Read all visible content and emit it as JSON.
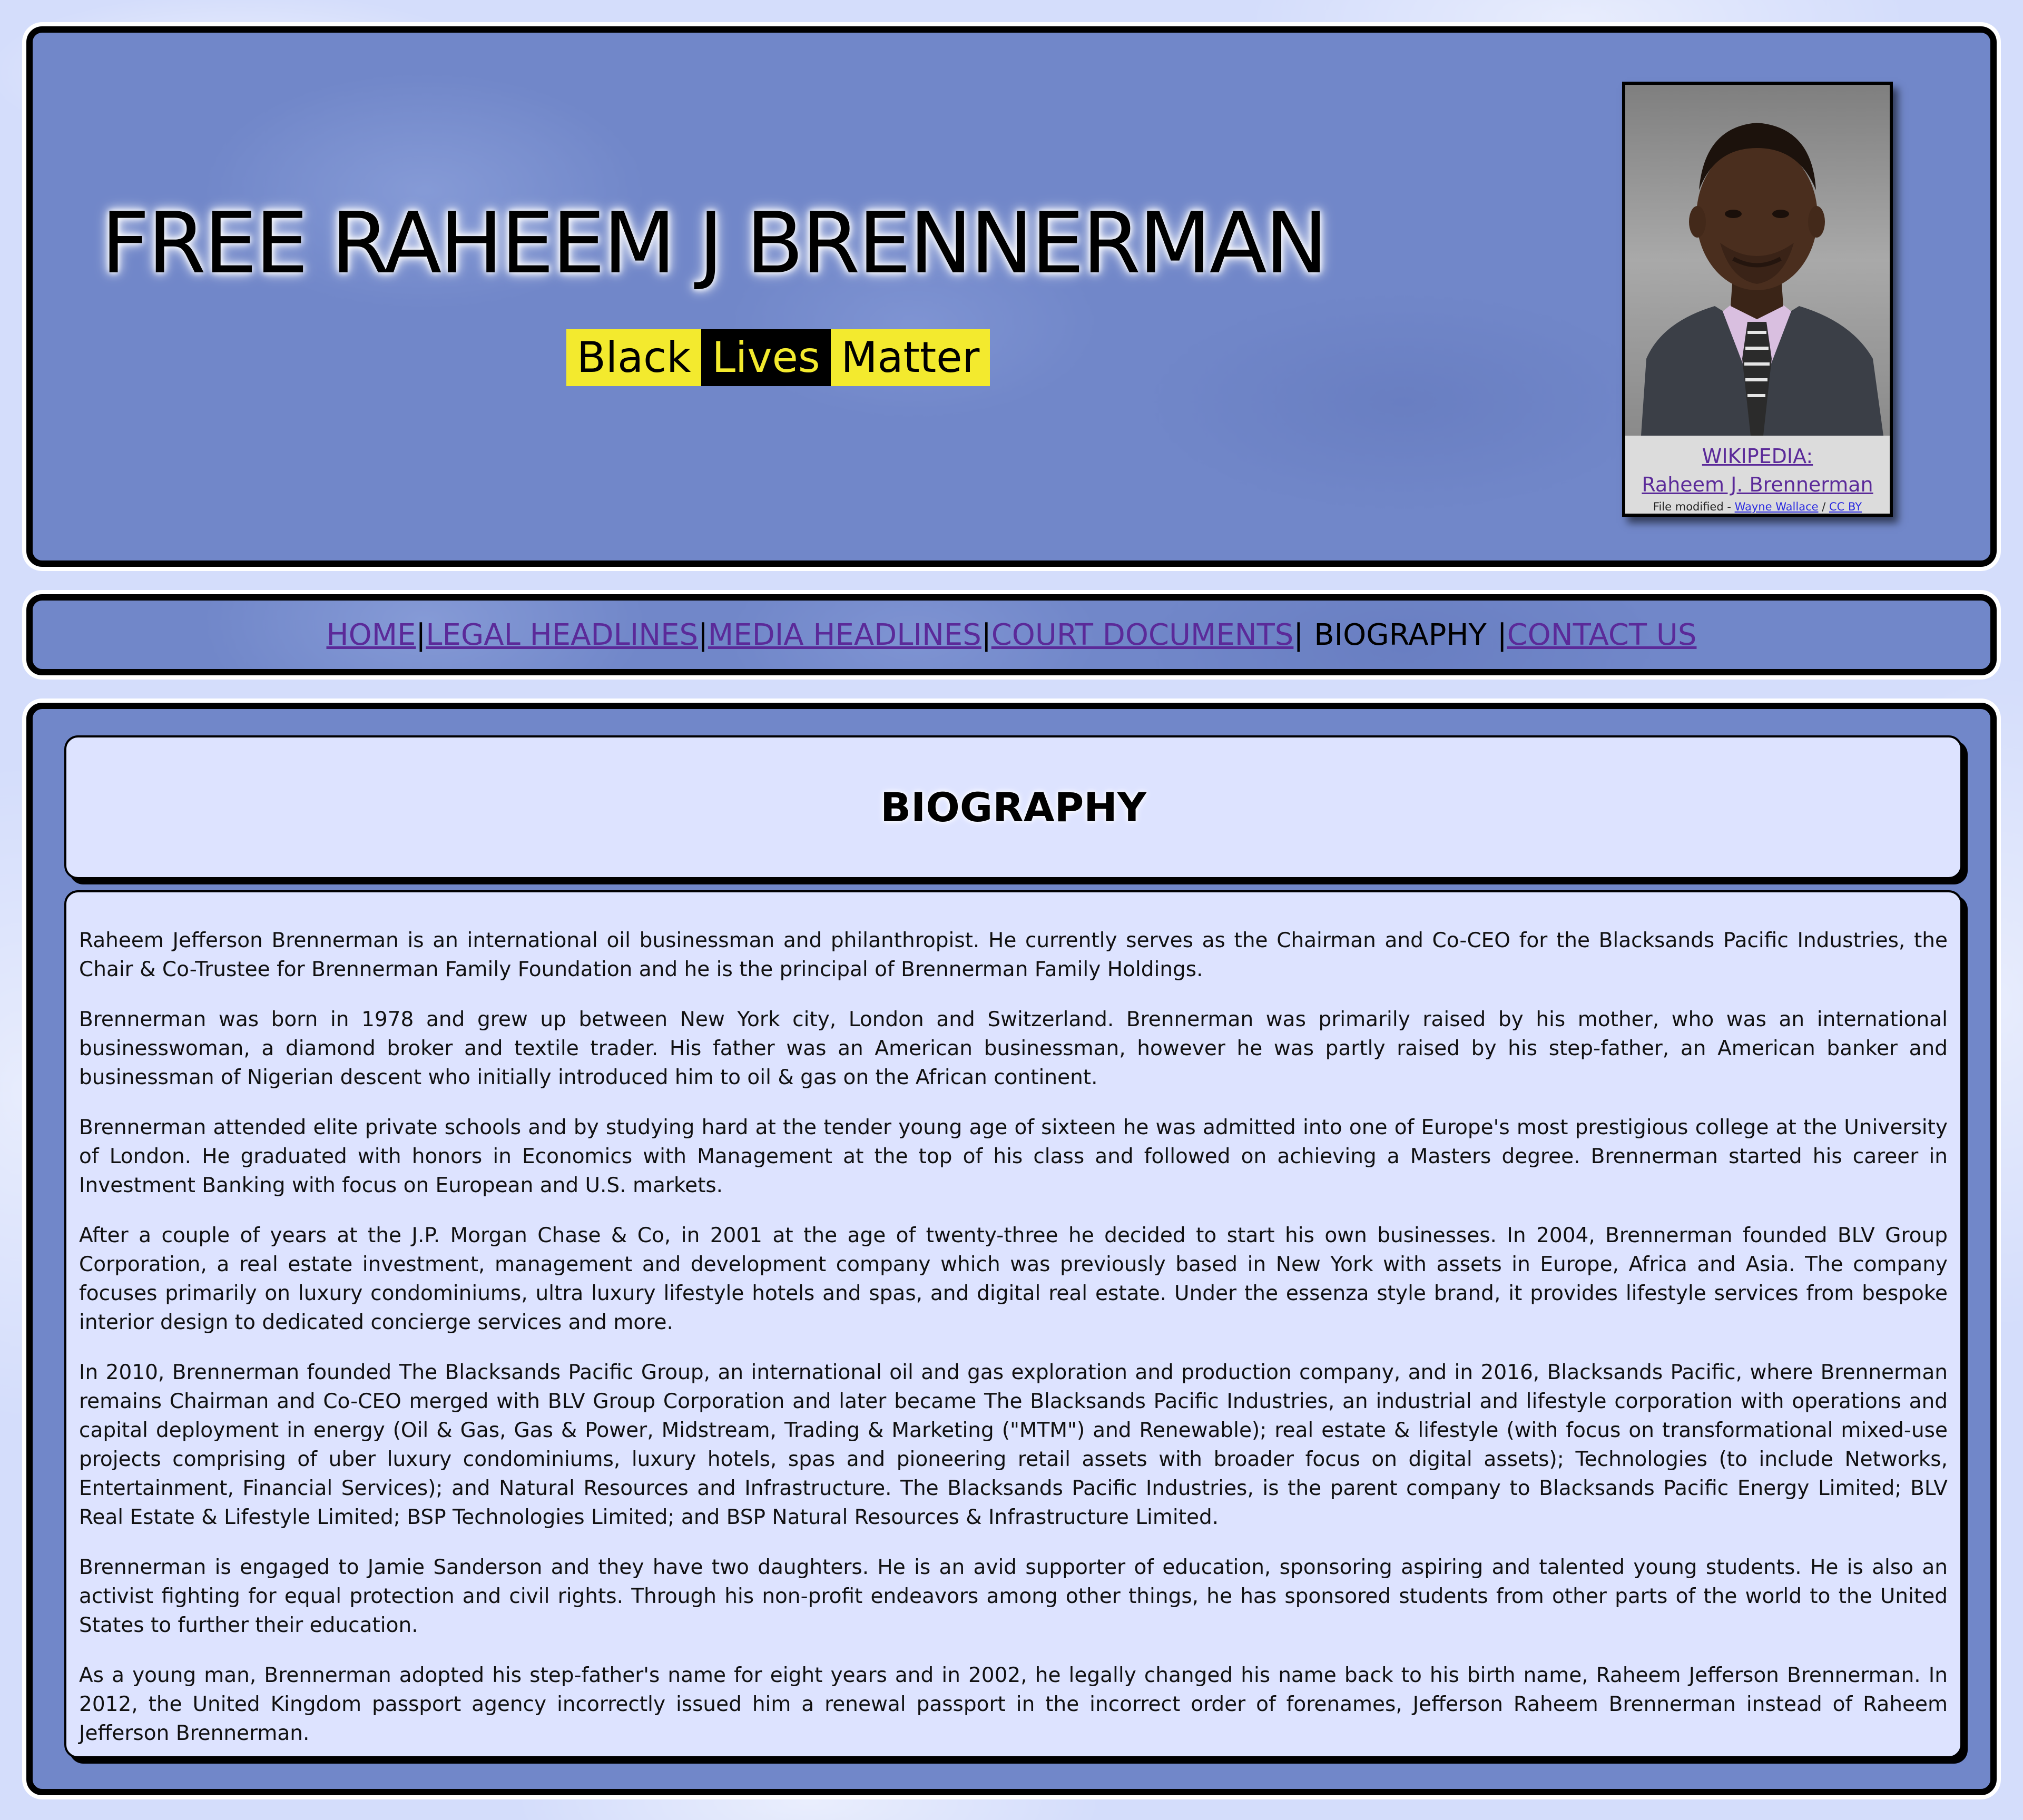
{
  "header": {
    "title": "FREE RAHEEM J BRENNERMAN",
    "blm": {
      "word1": "Black",
      "word2": "Lives",
      "word3": "Matter",
      "colors": {
        "yellow": "#f3ea2e",
        "black": "#000000"
      }
    },
    "portrait": {
      "caption_line1": "WIKIPEDIA:",
      "caption_line2": "Raheem J. Brennerman",
      "modified_prefix": "File modified - ",
      "author_link": "Wayne Wallace",
      "separator": " / ",
      "license_link": "CC BY"
    }
  },
  "nav": {
    "items": [
      {
        "label": "HOME"
      },
      {
        "label": "LEGAL HEADLINES"
      },
      {
        "label": "MEDIA HEADLINES"
      },
      {
        "label": "COURT DOCUMENTS"
      },
      {
        "label": "BIOGRAPHY",
        "current": true
      },
      {
        "label": "CONTACT US"
      }
    ],
    "separator": "|"
  },
  "main": {
    "heading": "BIOGRAPHY",
    "paragraphs": [
      "Raheem Jefferson Brennerman is an international oil businessman and philanthropist. He currently serves as the Chairman and Co-CEO for the Blacksands Pacific Industries, the Chair & Co-Trustee for Brennerman Family Foundation and he is the principal of Brennerman Family Holdings.",
      "Brennerman was born in 1978 and grew up between New York city, London and Switzerland. Brennerman was primarily raised by his mother, who was an international businesswoman, a diamond broker and textile trader. His father was an American businessman, however he was partly raised by his step-father, an American banker and businessman of Nigerian descent who initially introduced him to oil & gas on the African continent.",
      "Brennerman attended elite private schools and by studying hard at the tender young age of sixteen he was admitted into one of Europe's most prestigious college at the University of London. He graduated with honors in Economics with Management at the top of his class and followed on achieving a Masters degree. Brennerman started his career in Investment Banking with focus on European and U.S. markets.",
      "After a couple of years at the J.P. Morgan Chase & Co, in 2001 at the age of twenty-three he decided to start his own businesses. In 2004, Brennerman founded BLV Group Corporation, a real estate investment, management and development company which was previously based in New York with assets in Europe, Africa and Asia. The company focuses primarily on luxury condominiums, ultra luxury lifestyle hotels and spas, and digital real estate. Under the essenza style brand, it provides lifestyle services from bespoke interior design to dedicated concierge services and more.",
      "In 2010, Brennerman founded The Blacksands Pacific Group, an international oil and gas exploration and production company, and in 2016, Blacksands Pacific, where Brennerman remains Chairman and Co-CEO merged with BLV Group Corporation and later became The Blacksands Pacific Industries, an industrial and lifestyle corporation with operations and capital deployment in energy (Oil & Gas, Gas & Power, Midstream, Trading & Marketing (\"MTM\") and Renewable); real estate & lifestyle (with focus on transformational mixed-use projects comprising of uber luxury condominiums, luxury hotels, spas and pioneering retail assets with broader focus on digital assets); Technologies (to include Networks, Entertainment, Financial Services); and Natural Resources and Infrastructure. The Blacksands Pacific Industries, is the parent company to Blacksands Pacific Energy Limited; BLV Real Estate & Lifestyle Limited; BSP Technologies Limited; and BSP Natural Resources & Infrastructure Limited.",
      "Brennerman is engaged to Jamie Sanderson and they have two daughters. He is an avid supporter of education, sponsoring aspiring and talented young students. He is also an activist fighting for equal protection and civil rights. Through his non-profit endeavors among other things, he has sponsored students from other parts of the world to the United States to further their education.",
      "As a young man, Brennerman adopted his step-father's name for eight years and in 2002, he legally changed his name back to his birth name, Raheem Jefferson Brennerman. In 2012, the United Kingdom passport agency incorrectly issued him a renewal passport in the incorrect order of forenames, Jefferson Raheem Brennerman instead of Raheem Jefferson Brennerman."
    ]
  },
  "colors": {
    "panel": "#7187c9",
    "content_box": "#dde3ff",
    "link": "#5b2a99",
    "page_background": "#d4ddfb"
  }
}
